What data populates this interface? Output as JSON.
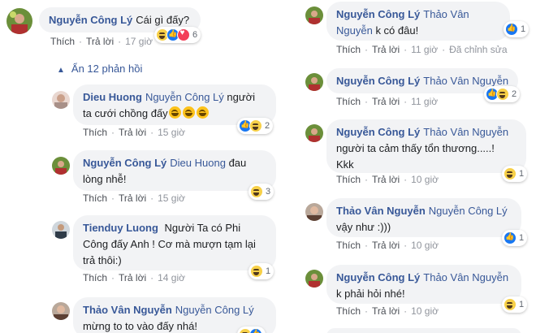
{
  "top_comment": {
    "author": "Nguyễn Công Lý",
    "text": "Cái gì đấy?",
    "actions": {
      "like": "Thích",
      "reply": "Trả lời",
      "time": "17 giờ"
    },
    "reactions": {
      "icons": [
        "haha-icon",
        "like-icon",
        "love-icon"
      ],
      "count": "6"
    }
  },
  "hide_replies": {
    "label": "Ẩn 12 phản hồi"
  },
  "left_replies": [
    {
      "author": "Dieu Huong",
      "tag": "Nguyễn Công Lý",
      "line1": "người",
      "line2": "ta cưới chồng đấy",
      "actions": {
        "like": "Thích",
        "reply": "Trả lời",
        "time": "15 giờ"
      },
      "reactions": {
        "icons": [
          "like-icon",
          "haha-icon"
        ],
        "count": "2"
      }
    },
    {
      "author": "Nguyễn Công Lý",
      "tag": "Dieu Huong",
      "line1": "đau",
      "line2": "lòng nhễ!",
      "actions": {
        "like": "Thích",
        "reply": "Trả lời",
        "time": "15 giờ"
      },
      "reactions": {
        "icons": [
          "haha-icon"
        ],
        "count": "3"
      }
    },
    {
      "author": "Tienduy Luong",
      "text1": "Người Ta có Phi",
      "text2": "Công đấy Anh ! Cơ mà mượn tạm lại",
      "text3": "trả thôi:)",
      "actions": {
        "like": "Thích",
        "reply": "Trả lời",
        "time": "14 giờ"
      },
      "reactions": {
        "icons": [
          "haha-icon"
        ],
        "count": "1"
      }
    },
    {
      "author": "Thảo Vân Nguyễn",
      "tag": "Nguyễn Công Lý",
      "line2": "mừng to to vào đấy nhá!"
    }
  ],
  "right_replies": [
    {
      "author": "Nguyễn Công Lý",
      "tag1": "Thảo Vân",
      "tag2": "Nguyễn",
      "text": "k có đâu!",
      "actions": {
        "like": "Thích",
        "reply": "Trả lời",
        "time": "11 giờ",
        "edited": "Đã chỉnh sửa"
      },
      "reactions": {
        "icons": [
          "like-icon"
        ],
        "count": "1"
      }
    },
    {
      "author": "Nguyễn Công Lý",
      "tag": "Thảo Vân Nguyễn",
      "actions": {
        "like": "Thích",
        "reply": "Trả lời",
        "time": "11 giờ"
      },
      "reactions": {
        "icons": [
          "like-icon",
          "haha-icon"
        ],
        "count": "2"
      }
    },
    {
      "author": "Nguyễn Công Lý",
      "tag": "Thảo Vân Nguyễn",
      "text1": "người ta cảm thấy tổn thương.....!",
      "text2": "Kkk",
      "actions": {
        "like": "Thích",
        "reply": "Trả lời",
        "time": "10 giờ"
      },
      "reactions": {
        "icons": [
          "haha-icon"
        ],
        "count": "1"
      }
    },
    {
      "author": "Thảo Vân Nguyễn",
      "tag": "Nguyễn Công Lý",
      "text": "vậy như :)))",
      "actions": {
        "like": "Thích",
        "reply": "Trả lời",
        "time": "10 giờ"
      },
      "reactions": {
        "icons": [
          "like-icon"
        ],
        "count": "1"
      }
    },
    {
      "author": "Nguyễn Công Lý",
      "tag": "Thảo Vân Nguyễn",
      "text": "k phải hỏi nhé!",
      "actions": {
        "like": "Thích",
        "reply": "Trả lời",
        "time": "10 giờ"
      },
      "reactions": {
        "icons": [
          "haha-icon"
        ],
        "count": "1"
      }
    }
  ]
}
